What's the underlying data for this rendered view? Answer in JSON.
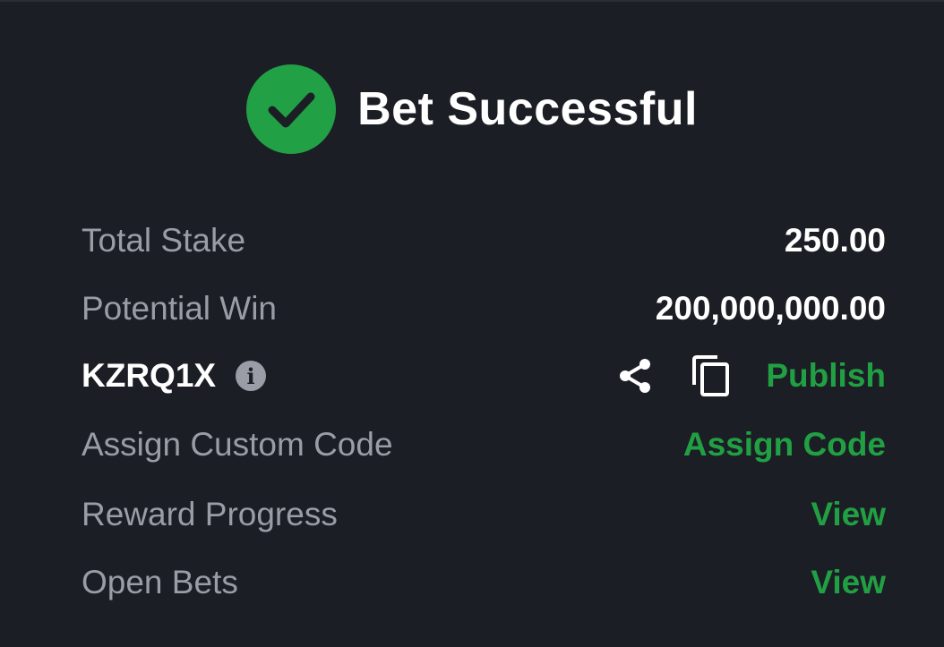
{
  "header": {
    "title": "Bet Successful",
    "status_icon": "check-circle-icon",
    "accent_color": "#22a045"
  },
  "details": {
    "total_stake": {
      "label": "Total Stake",
      "value": "250.00"
    },
    "potential_win": {
      "label": "Potential Win",
      "value": "200,000,000.00"
    },
    "booking_code": {
      "code": "KZRQ1X",
      "info_icon": "info-icon",
      "share_icon": "share-icon",
      "copy_icon": "copy-icon",
      "publish_label": "Publish"
    },
    "custom_code": {
      "label": "Assign Custom Code",
      "action": "Assign Code"
    },
    "reward_progress": {
      "label": "Reward Progress",
      "action": "View"
    },
    "open_bets": {
      "label": "Open Bets",
      "action": "View"
    }
  }
}
